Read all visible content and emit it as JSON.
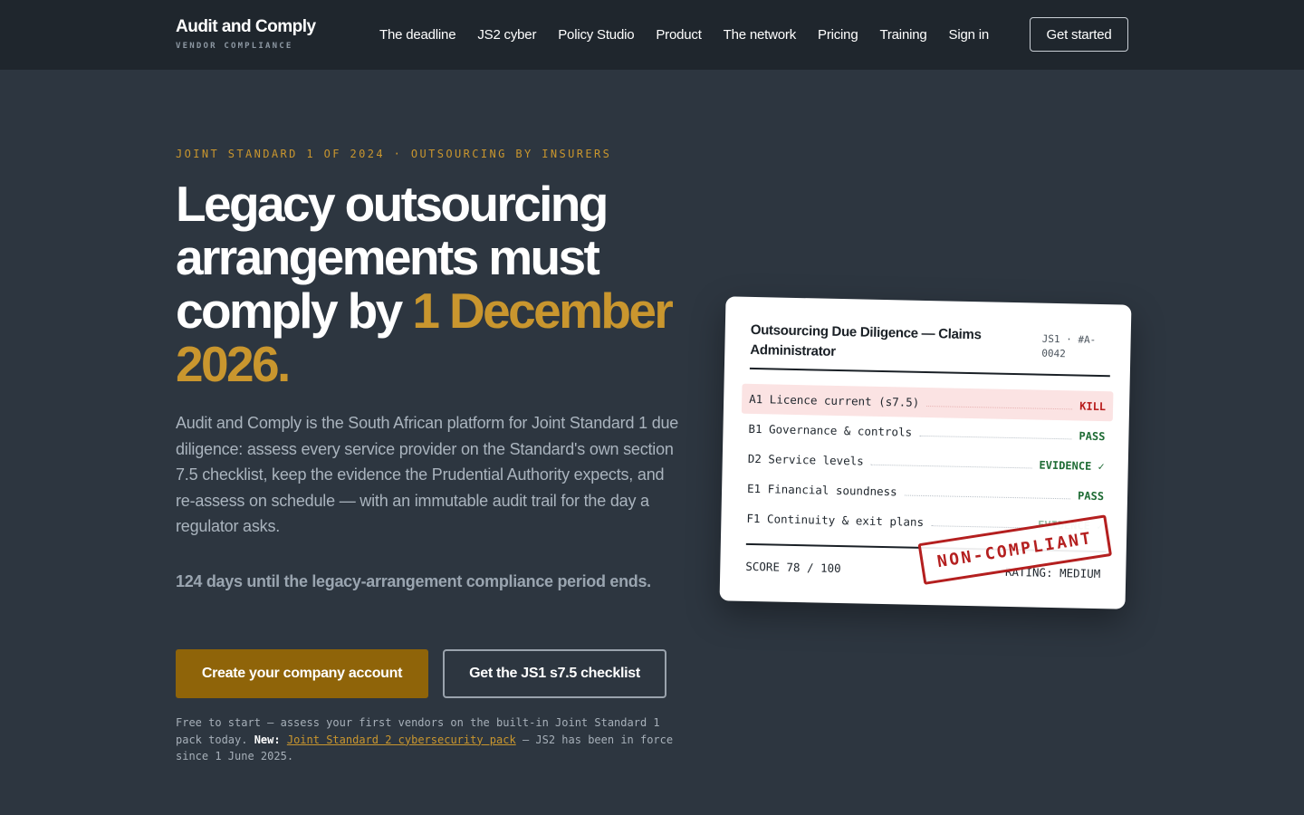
{
  "nav": {
    "brand_name": "Audit and Comply",
    "brand_tag": "VENDOR COMPLIANCE",
    "links": [
      "The deadline",
      "JS2 cyber",
      "Policy Studio",
      "Product",
      "The network",
      "Pricing",
      "Training",
      "Sign in"
    ],
    "cta": "Get started"
  },
  "hero": {
    "eyebrow": "JOINT STANDARD 1 OF 2024 · OUTSOURCING BY INSURERS",
    "headline_plain": "Legacy outsourcing arrangements must comply by ",
    "headline_accent": "1 December 2026.",
    "lede": "Audit and Comply is the South African platform for Joint Standard 1 due diligence: assess every service provider on the Standard's own section 7.5 checklist, keep the evidence the Prudential Authority expects, and re-assess on schedule — with an immutable audit trail for the day a regulator asks.",
    "countdown": "124 days until the legacy-arrangement compliance period ends.",
    "primary_button": "Create your company account",
    "secondary_button": "Get the JS1 s7.5 checklist",
    "fineprint_lead": "Free to start — assess your first vendors on the built-in Joint Standard 1 pack today. ",
    "fineprint_new": "New:",
    "fineprint_link": "Joint Standard 2 cybersecurity pack",
    "fineprint_tail": " — JS2 has been in force since 1 June 2025."
  },
  "card": {
    "title": "Outsourcing Due Diligence — Claims Administrator",
    "ref": "JS1 · #A-0042",
    "rows": [
      {
        "label": "A1 Licence current (s7.5)",
        "status": "KILL"
      },
      {
        "label": "B1 Governance & controls",
        "status": "PASS"
      },
      {
        "label": "D2 Service levels",
        "status": "EVIDENCE ✓"
      },
      {
        "label": "E1 Financial soundness",
        "status": "PASS"
      },
      {
        "label": "F1 Continuity & exit plans",
        "status": "EVIDENCE ✓"
      }
    ],
    "score": "SCORE 78 / 100",
    "rating": "RATING: MEDIUM",
    "stamp": "NON-COMPLIANT"
  },
  "colors": {
    "background": "#2d3640",
    "navbar": "#1f262d",
    "accent": "#c9962e",
    "primary_button": "#8f6409",
    "kill": "#b81c1c",
    "pass": "#1e6b34"
  }
}
